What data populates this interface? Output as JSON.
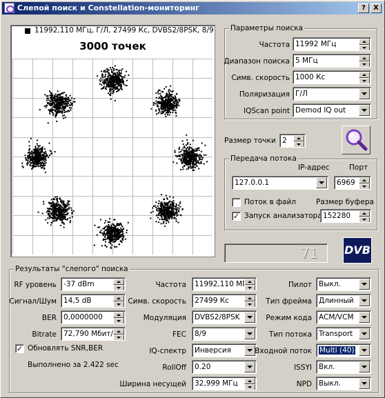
{
  "title": "Слепой поиск и Constellation-мониторинг",
  "title_buttons": {
    "help": "?",
    "close": "X"
  },
  "plot": {
    "header": "11992,110 МГц, Г/Л, 27499 Кс, DVBS2/8PSK, 8/9",
    "points_label": "3000 точек",
    "modulation": "8PSK",
    "symbols": 8,
    "points": 3000
  },
  "search_params": {
    "title": "Параметры поиска",
    "freq_label": "Частота",
    "freq_value": "11992 МГц",
    "range_label": "Диапазон поиска",
    "range_value": "5 МГц",
    "sr_label": "Симв. скорость",
    "sr_value": "1000 Кс",
    "pol_label": "Поляризация",
    "pol_value": "Г/Л",
    "iq_label": "IQScan point",
    "iq_value": "Demod IQ out"
  },
  "point_size": {
    "label": "Размер точки",
    "value": "2"
  },
  "stream": {
    "title": "Передача потока",
    "ip_label": "IP-адрес",
    "ip_value": "127.0.0.1",
    "port_label": "Порт",
    "port_value": "6969",
    "to_file_label": "Поток в файл",
    "to_file_checked": "",
    "analyzer_label": "Запуск анализатора",
    "analyzer_checked": "✓",
    "buffer_label": "Размер буфера",
    "buffer_value": "152280"
  },
  "lcd_value": "71",
  "dvb_logo": "DVB",
  "results": {
    "title": "Результаты \"слепого\" поиска",
    "rf_label": "RF уровень",
    "rf_value": "-37 dBm",
    "snr_label": "Сигнал/Шум",
    "snr_value": "14,5 dB",
    "ber_label": "BER",
    "ber_value": "0,0000000",
    "bitrate_label": "Bitrate",
    "bitrate_value": "72,790 Мбит/с",
    "update_label": "Обновлять SNR,BER",
    "update_checked": "✓",
    "done_text": "Выполнено за 2.422 sec",
    "freq_label": "Частота",
    "freq_value": "11992,110 МГц",
    "sr_label": "Симв. скорость",
    "sr_value": "27499 Кс",
    "mod_label": "Модуляция",
    "mod_value": "DVBS2/8PSK",
    "fec_label": "FEC",
    "fec_value": "8/9",
    "iqspec_label": "IQ-спектр",
    "iqspec_value": "Инверсия",
    "rolloff_label": "RollOff",
    "rolloff_value": "0.20",
    "bw_label": "Ширина несущей",
    "bw_value": "32,999 МГц",
    "pilot_label": "Пилот",
    "pilot_value": "Выкл.",
    "frame_label": "Тип фрейма",
    "frame_value": "Длинный",
    "code_label": "Режим кода",
    "code_value": "ACM/VCM",
    "stype_label": "Тип потока",
    "stype_value": "Transport",
    "instream_label": "Входной поток",
    "instream_value": "Multi (40)",
    "issyi_label": "ISSYI",
    "issyi_value": "Вкл.",
    "npd_label": "NPD",
    "npd_value": "Выкл."
  }
}
